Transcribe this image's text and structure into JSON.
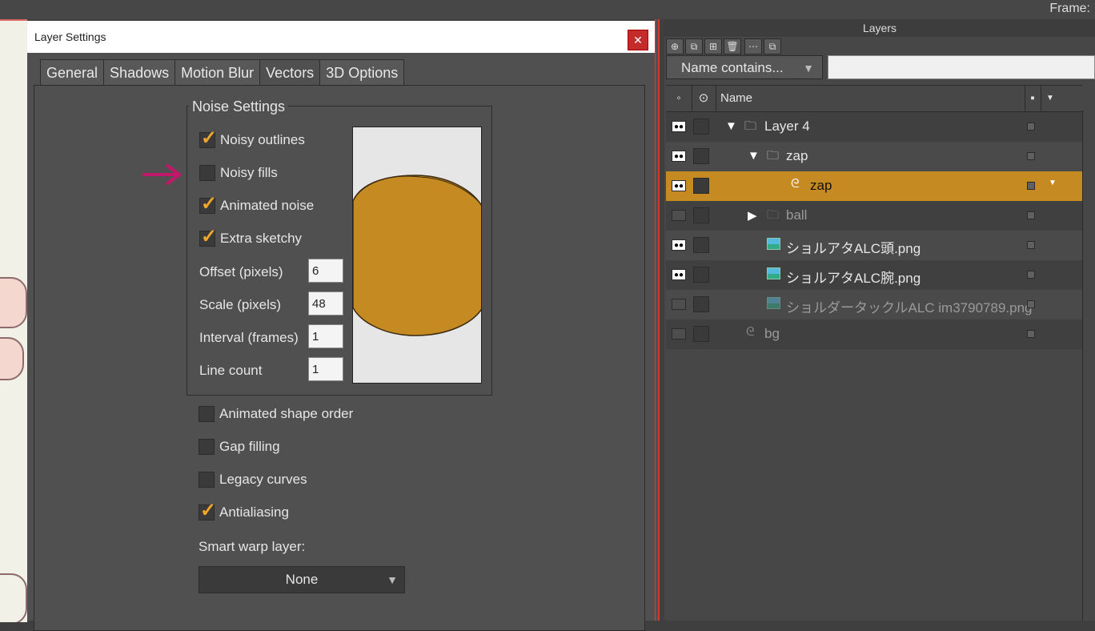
{
  "topbar": {
    "frame_label": "Frame:"
  },
  "dialog": {
    "title": "Layer Settings",
    "close_glyph": "✕",
    "tabs": [
      "General",
      "Shadows",
      "Motion Blur",
      "Vectors",
      "3D Options"
    ],
    "active_tab": "Vectors",
    "noise_settings": {
      "group_title": "Noise Settings",
      "checkboxes": [
        {
          "label": "Noisy outlines",
          "checked": true
        },
        {
          "label": "Noisy fills",
          "checked": false
        },
        {
          "label": "Animated noise",
          "checked": true
        },
        {
          "label": "Extra sketchy",
          "checked": true
        }
      ],
      "fields": [
        {
          "label": "Offset (pixels)",
          "value": "6"
        },
        {
          "label": "Scale (pixels)",
          "value": "48"
        },
        {
          "label": "Interval (frames)",
          "value": "1"
        },
        {
          "label": "Line count",
          "value": "1"
        }
      ],
      "preview_fill_color": "#c68a22"
    },
    "options": [
      {
        "label": "Animated shape order",
        "checked": false
      },
      {
        "label": "Gap filling",
        "checked": false
      },
      {
        "label": "Legacy curves",
        "checked": false
      },
      {
        "label": "Antialiasing",
        "checked": true
      }
    ],
    "smart_warp": {
      "label": "Smart warp layer:",
      "value": "None"
    }
  },
  "layers_panel": {
    "title": "Layers",
    "filter": {
      "label": "Name contains..."
    },
    "column_name": "Name",
    "rows": [
      {
        "name": "Layer 4",
        "type": "folder",
        "expanded": true,
        "visible": true,
        "selected": false,
        "dim": false
      },
      {
        "name": "zap",
        "type": "folder",
        "expanded": true,
        "visible": true,
        "selected": false,
        "dim": false
      },
      {
        "name": "zap",
        "type": "vector",
        "visible": true,
        "selected": true,
        "dim": false
      },
      {
        "name": "ball",
        "type": "folder",
        "expanded": false,
        "visible": false,
        "selected": false,
        "dim": true
      },
      {
        "name": "ショルアタALC頭.png",
        "type": "image",
        "visible": true,
        "selected": false,
        "dim": false
      },
      {
        "name": "ショルアタALC腕.png",
        "type": "image",
        "visible": true,
        "selected": false,
        "dim": false
      },
      {
        "name": "ショルダータックルALC im3790789.png",
        "type": "image",
        "visible": false,
        "selected": false,
        "dim": true
      },
      {
        "name": "bg",
        "type": "vector",
        "visible": false,
        "selected": false,
        "dim": true
      }
    ]
  },
  "colors": {
    "accent": "#c68a22",
    "checkmark": "#f0a72a",
    "pointer_arrow": "#c2186b"
  }
}
